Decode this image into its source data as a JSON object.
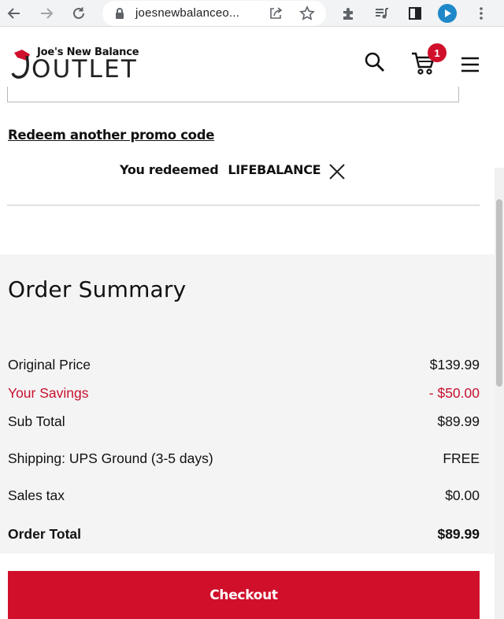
{
  "browser": {
    "url": "joesnewbalanceo...",
    "extension_badge_color": "#1e88c9"
  },
  "header": {
    "logo_top": "Joe's New Balance",
    "logo_bottom": "OUTLET",
    "cart_count": "1",
    "brand_color": "#d0102b"
  },
  "promo": {
    "redeem_link": "Redeem another promo code",
    "redeemed_label": "You redeemed",
    "redeemed_code": "LIFEBALANCE"
  },
  "summary": {
    "title": "Order Summary",
    "rows": [
      {
        "label": "Original Price",
        "value": "$139.99"
      },
      {
        "label": "Your Savings",
        "value": "- $50.00"
      },
      {
        "label": "Sub Total",
        "value": "$89.99"
      },
      {
        "label": "Shipping: UPS Ground (3-5 days)",
        "value": "FREE"
      },
      {
        "label": "Sales tax",
        "value": "$0.00"
      },
      {
        "label": "Order Total",
        "value": "$89.99"
      }
    ],
    "savings_color": "#c8102e"
  },
  "checkout": {
    "label": "Checkout"
  }
}
